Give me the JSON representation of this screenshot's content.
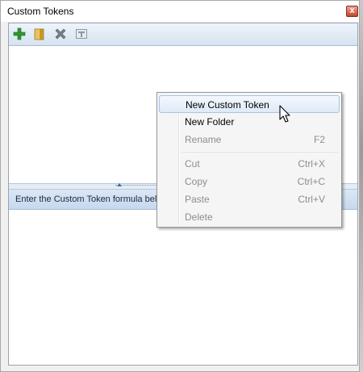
{
  "window": {
    "title": "Custom Tokens",
    "close_glyph": "x"
  },
  "toolbar": {
    "icons": [
      "add-icon",
      "folder-icon",
      "delete-icon",
      "text-token-icon"
    ]
  },
  "info_bar": {
    "text": "Enter the Custom Token formula belo"
  },
  "context_menu": {
    "items": [
      {
        "label": "New Custom Token",
        "shortcut": "",
        "enabled": true,
        "highlighted": true
      },
      {
        "label": "New Folder",
        "shortcut": "",
        "enabled": true,
        "highlighted": false
      },
      {
        "label": "Rename",
        "shortcut": "F2",
        "enabled": false,
        "highlighted": false
      },
      {
        "label": "Cut",
        "shortcut": "Ctrl+X",
        "enabled": false,
        "highlighted": false
      },
      {
        "label": "Copy",
        "shortcut": "Ctrl+C",
        "enabled": false,
        "highlighted": false
      },
      {
        "label": "Paste",
        "shortcut": "Ctrl+V",
        "enabled": false,
        "highlighted": false
      },
      {
        "label": "Delete",
        "shortcut": "",
        "enabled": false,
        "highlighted": false
      }
    ]
  },
  "colors": {
    "toolbar_bg": "#d6e3f1",
    "highlight_border": "#a8c4e6",
    "disabled_text": "#8d8d8d"
  }
}
